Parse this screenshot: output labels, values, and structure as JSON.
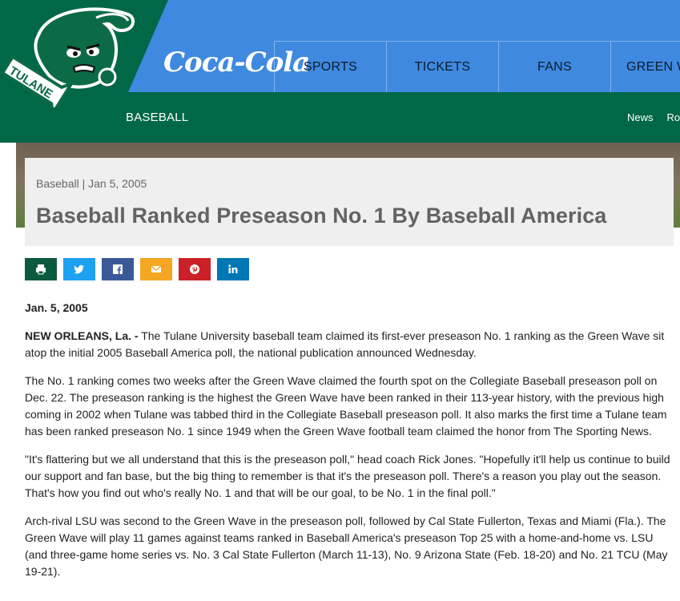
{
  "header": {
    "sponsor": "Coca-Cola",
    "nav": [
      "SPORTS",
      "TICKETS",
      "FANS",
      "GREEN W"
    ],
    "section_title": "BASEBALL",
    "subnav": [
      "News",
      "Ros"
    ],
    "logo_text": "TULANE"
  },
  "colors": {
    "green": "#006747",
    "blue": "#3f89e0"
  },
  "article": {
    "meta": "Baseball | Jan 5, 2005",
    "title": "Baseball Ranked Preseason No. 1 By Baseball America",
    "share_icons": [
      "print-icon",
      "twitter-icon",
      "facebook-icon",
      "email-icon",
      "pinterest-icon",
      "linkedin-icon"
    ],
    "date": "Jan. 5, 2005",
    "dateline": "NEW ORLEANS, La. -",
    "p1": " The Tulane University baseball team claimed its first-ever preseason No. 1 ranking as the Green Wave sit atop the initial 2005 Baseball America poll, the national publication announced Wednesday.",
    "p2": "The No. 1 ranking comes two weeks after the Green Wave claimed the fourth spot on the Collegiate Baseball preseason poll on Dec. 22. The preseason ranking is the highest the Green Wave have been ranked in their 113-year history, with the previous high coming in 2002 when Tulane was tabbed third in the Collegiate Baseball preseason poll. It also marks the first time a Tulane team has been ranked preseason No. 1 since 1949 when the Green Wave football team claimed the honor from The Sporting News.",
    "p3": "\"It's flattering but we all understand that this is the preseason poll,\" head coach Rick Jones. \"Hopefully it'll help us continue to build our support and fan base, but the big thing to remember is that it's the preseason poll. There's a reason you play out the season. That's how you find out who's really No. 1 and that will be our goal, to be No. 1 in the final poll.\"",
    "p4": "Arch-rival LSU was second to the Green Wave in the preseason poll, followed by Cal State Fullerton, Texas and Miami (Fla.). The Green Wave will play 11 games against teams ranked in Baseball America's preseason Top 25 with a home-and-home vs. LSU (and three-game home series vs. No. 3 Cal State Fullerton (March 11-13), No. 9 Arizona State (Feb. 18-20) and No. 21 TCU (May 19-21)."
  }
}
